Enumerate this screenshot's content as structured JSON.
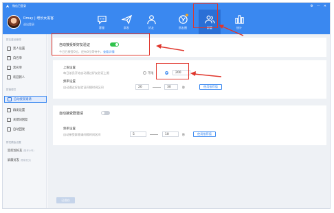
{
  "app": {
    "title": "微信已登录"
  },
  "window": {
    "settings_icon": "gear-icon",
    "minimize_icon": "minus-icon",
    "close_icon": "close-icon"
  },
  "user": {
    "name": "Rmay | 增长女黑客",
    "status": "退出登录"
  },
  "nav": [
    {
      "label": "客服",
      "icon": "chat-bubble-icon"
    },
    {
      "label": "群发",
      "icon": "paper-plane-icon"
    },
    {
      "label": "好友",
      "icon": "user-icon"
    },
    {
      "label": "朋友圈",
      "icon": "camera-aperture-icon"
    },
    {
      "label": "群管",
      "icon": "group-icon",
      "active": true
    },
    {
      "label": "统计",
      "icon": "bar-chart-icon"
    }
  ],
  "sidebar": {
    "section1": "群友建设管理",
    "items1": [
      "黑人设置",
      "白名单",
      "黑名单",
      "欢迎新人"
    ],
    "section2": "群管理员",
    "items2": [
      "自动接受邀请",
      "群发设置",
      "关键词回复",
      "自动回复"
    ],
    "section3": "群发模板设置",
    "plain": [
      {
        "label": "监控加好友",
        "note": "(账号小号)"
      },
      {
        "label": "屏蔽好友",
        "note": "(限制发文)"
      }
    ]
  },
  "main": {
    "card1": {
      "title": "自动接受新好友验证",
      "toggle": "on",
      "desc": "今日已接受0位，还有0位等待中，",
      "link": "查看详情"
    },
    "card2": {
      "limit_title": "上限设置",
      "limit_desc": "每日该员开始自动通过好友验证上限",
      "opt_unlimited": "不限",
      "limit_value": "200",
      "limit_unit": "人",
      "freq_title": "频率设置",
      "freq_desc": "自动通过好友验证间隔时间区间",
      "freq_min": "20",
      "freq_max": "30",
      "freq_unit": "秒",
      "template_btn": "使用推荐值"
    },
    "card3": {
      "title": "自动接受群邀请",
      "toggle": "off",
      "freq_title": "频率设置",
      "freq_desc": "自动接受群邀请间隔时间区间",
      "freq_min": "5",
      "freq_max": "10",
      "freq_unit": "秒",
      "template_btn": "使用推荐值"
    },
    "save_btn": "已保存"
  },
  "colors": {
    "header": "#3a88f0",
    "accent": "#3a88f0",
    "annotation": "#e0362c",
    "toggle_on": "#2fc24b"
  }
}
